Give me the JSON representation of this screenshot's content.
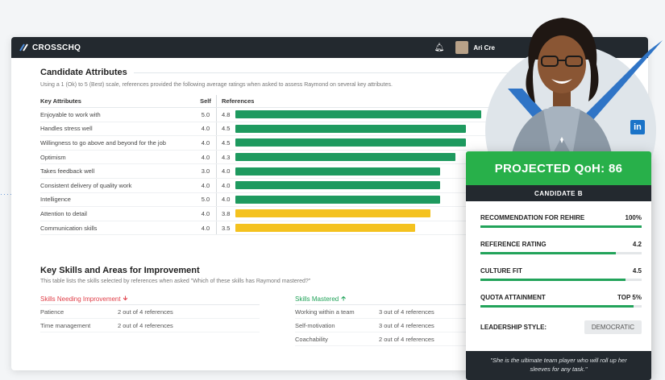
{
  "header": {
    "logo_text": "CROSSCHQ",
    "user_name": "Ari Cre"
  },
  "attributes": {
    "title": "Candidate Attributes",
    "description": "Using a 1 (Ok) to 5 (Best) scale, references provided the following average ratings when asked to assess Raymond on several key attributes.",
    "col_attr": "Key Attributes",
    "col_self": "Self",
    "col_ref": "References",
    "rows": [
      {
        "name": "Enjoyable to work with",
        "self": "5.0",
        "ref": "4.8",
        "value": 4.8
      },
      {
        "name": "Handles stress well",
        "self": "4.0",
        "ref": "4.5",
        "value": 4.5
      },
      {
        "name": "Willingness to go above and beyond for the job",
        "self": "4.0",
        "ref": "4.5",
        "value": 4.5
      },
      {
        "name": "Optimism",
        "self": "4.0",
        "ref": "4.3",
        "value": 4.3
      },
      {
        "name": "Takes feedback well",
        "self": "3.0",
        "ref": "4.0",
        "value": 4.0
      },
      {
        "name": "Consistent delivery of quality work",
        "self": "4.0",
        "ref": "4.0",
        "value": 4.0
      },
      {
        "name": "Intelligence",
        "self": "5.0",
        "ref": "4.0",
        "value": 4.0
      },
      {
        "name": "Attention to detail",
        "self": "4.0",
        "ref": "3.8",
        "value": 3.8
      },
      {
        "name": "Communication skills",
        "self": "4.0",
        "ref": "3.5",
        "value": 3.5
      }
    ],
    "max_value": 5.0,
    "color_high": "#1e9a5f",
    "color_low": "#f4c21f"
  },
  "skills": {
    "title": "Key Skills and Areas for Improvement",
    "description": "This table lists the skills selected by references when asked \"Which of these skills has Raymond mastered?\"",
    "improve_label": "Skills Needing Improvement",
    "improve_icon": "arrow-down-icon",
    "improve": [
      {
        "skill": "Patience",
        "count": "2 out of 4 references"
      },
      {
        "skill": "Time management",
        "count": "2 out of 4 references"
      }
    ],
    "mastered_label": "Skills Mastered",
    "mastered_icon": "arrow-up-icon",
    "mastered": [
      {
        "skill": "Working within a team",
        "count": "3 out of 4 references"
      },
      {
        "skill": "Self-motivation",
        "count": "3 out of 4 references"
      },
      {
        "skill": "Coachability",
        "count": "2 out of 4 references"
      }
    ]
  },
  "card": {
    "qoh_label": "PROJECTED QoH:",
    "qoh_value": "86",
    "candidate": "CANDIDATE B",
    "metrics": [
      {
        "label": "RECOMMENDATION FOR REHIRE",
        "value": "100%",
        "fill": 1.0
      },
      {
        "label": "REFERENCE RATING",
        "value": "4.2",
        "fill": 0.84
      },
      {
        "label": "CULTURE FIT",
        "value": "4.5",
        "fill": 0.9
      },
      {
        "label": "QUOTA ATTAINMENT",
        "value": "TOP 5%",
        "fill": 0.95
      }
    ],
    "leadership_label": "LEADERSHIP STYLE:",
    "leadership_value": "DEMOCRATIC",
    "quote": "\"She is the ultimate team player who will roll up her sleeves for any task.\""
  },
  "social": {
    "linkedin": "in"
  }
}
